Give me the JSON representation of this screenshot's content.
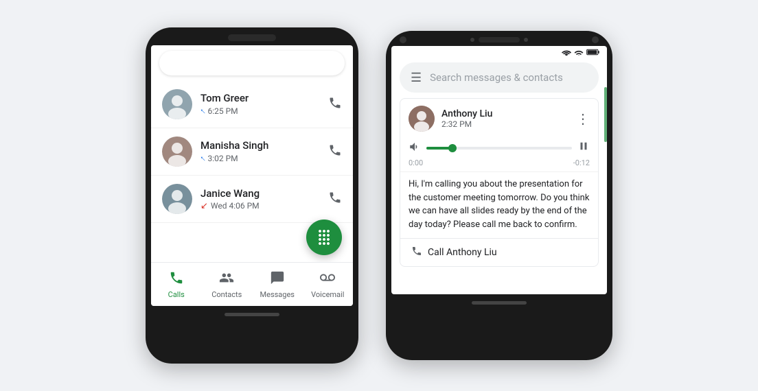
{
  "left_phone": {
    "contacts": [
      {
        "name": "Tom Greer",
        "time": "6:25 PM",
        "call_type": "outgoing",
        "avatar_color": "#90a4ae",
        "avatar_text": "👤"
      },
      {
        "name": "Manisha Singh",
        "time": "3:02 PM",
        "call_type": "outgoing",
        "avatar_color": "#a1887f",
        "avatar_text": "👤"
      },
      {
        "name": "Janice Wang",
        "time": "Wed 4:06 PM",
        "call_type": "missed",
        "avatar_color": "#78909c",
        "avatar_text": "👤"
      }
    ],
    "nav_items": [
      {
        "label": "Calls",
        "active": true
      },
      {
        "label": "Contacts",
        "active": false
      },
      {
        "label": "Messages",
        "active": false
      },
      {
        "label": "Voicemail",
        "active": false
      }
    ]
  },
  "right_phone": {
    "search_placeholder": "Search messages & contacts",
    "voicemail": {
      "contact_name": "Anthony Liu",
      "time": "2:32 PM",
      "audio_current": "0:00",
      "audio_total": "-0:12",
      "transcript": "Hi, I'm calling you about the presentation for the customer meeting tomorrow. Do you think we can have all slides ready by the end of the day today? Please call me back to confirm.",
      "callback_label": "Call Anthony Liu"
    }
  },
  "icons": {
    "phone": "📞",
    "dialpad": "⠿",
    "hamburger": "☰",
    "more_vert": "⋮",
    "speaker": "🔊",
    "pause": "⏸",
    "callback_phone": "📞"
  }
}
